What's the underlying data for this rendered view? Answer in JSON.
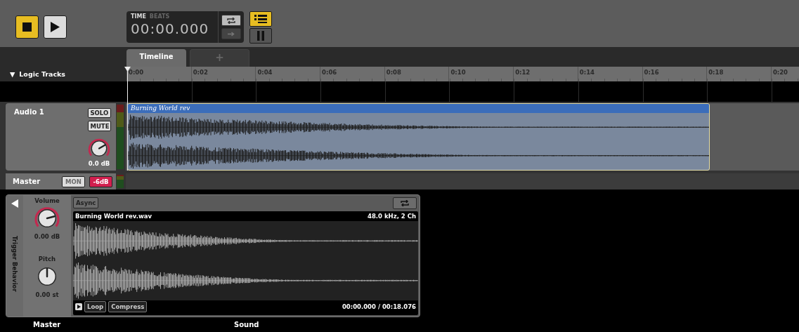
{
  "transport": {
    "buttons": [
      {
        "kind": "stop",
        "selected": true
      },
      {
        "kind": "play",
        "selected": false
      }
    ]
  },
  "time_display": {
    "modes": [
      {
        "label": "TIME",
        "selected": true
      },
      {
        "label": "BEATS",
        "selected": false
      }
    ],
    "value": "00:00.000",
    "buttons": [
      {
        "kind": "loop",
        "on": true
      },
      {
        "kind": "follow",
        "on": false
      }
    ]
  },
  "view_buttons": [
    {
      "kind": "list",
      "on": true
    },
    {
      "kind": "pause",
      "on": false
    }
  ],
  "tabs": [
    {
      "label": "Timeline",
      "selected": true
    },
    {
      "label": "+",
      "selected": false
    }
  ],
  "tracks_header": {
    "expander": "▼",
    "label": "Logic Tracks"
  },
  "ruler": {
    "ticks": [
      "0:00",
      "0:02",
      "0:04",
      "0:06",
      "0:08",
      "0:10",
      "0:12",
      "0:14",
      "0:16",
      "0:18",
      "0:20"
    ]
  },
  "tracks": [
    {
      "name": "Audio 1",
      "buttons": [
        {
          "label": "SOLO",
          "on": false,
          "disabled": false
        },
        {
          "label": "MUTE",
          "on": false,
          "disabled": false
        }
      ],
      "gain": "0.0 dB",
      "clip": {
        "title": "Burning World rev"
      }
    }
  ],
  "master": {
    "name": "Master",
    "buttons": [
      {
        "label": "MON",
        "on": false,
        "disabled": true
      },
      {
        "label": "-6dB",
        "on": true,
        "disabled": false
      }
    ]
  },
  "device": {
    "side_label": "Trigger Behavior",
    "knobs": [
      {
        "kind": "volume",
        "label": "Volume",
        "value": "0.00 dB"
      },
      {
        "kind": "pitch",
        "label": "Pitch",
        "value": "0.00 st"
      }
    ],
    "mode_button": "Async",
    "file": "Burning World rev.wav",
    "format": "48.0 kHz, 2 Ch",
    "options": [
      {
        "label": "Loop",
        "on": false
      },
      {
        "label": "Compress",
        "on": false
      }
    ],
    "position": "00:00.000 / 00:18.076"
  },
  "footer": [
    {
      "label": "Master"
    },
    {
      "label": "Sound"
    }
  ]
}
